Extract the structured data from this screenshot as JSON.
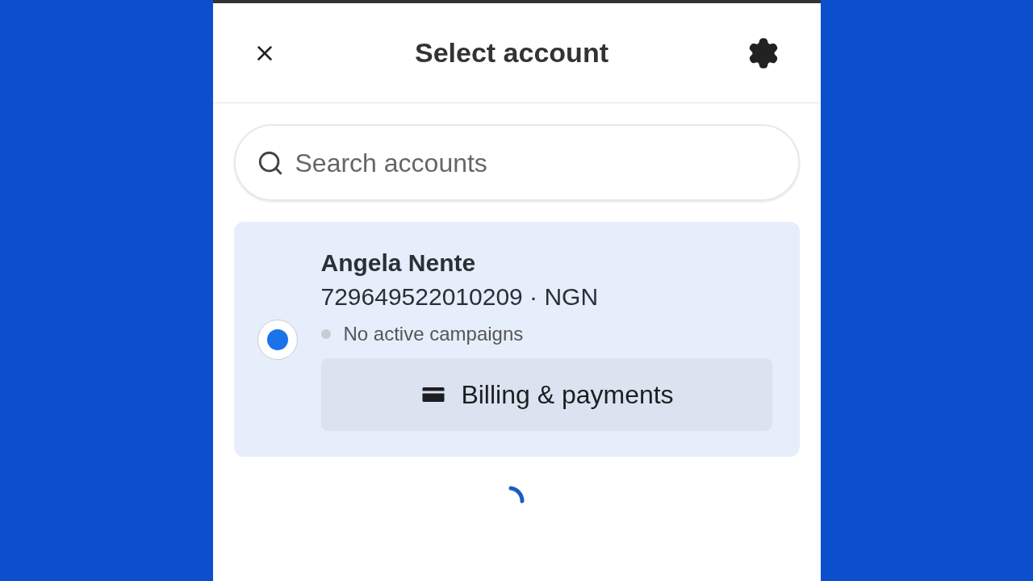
{
  "header": {
    "title": "Select account"
  },
  "search": {
    "placeholder": "Search accounts"
  },
  "accounts": [
    {
      "name": "Angela Nente",
      "id_line": "729649522010209 · NGN",
      "status": "No active campaigns",
      "active": false,
      "selected": true,
      "action": "Billing & payments"
    }
  ],
  "loading": true
}
